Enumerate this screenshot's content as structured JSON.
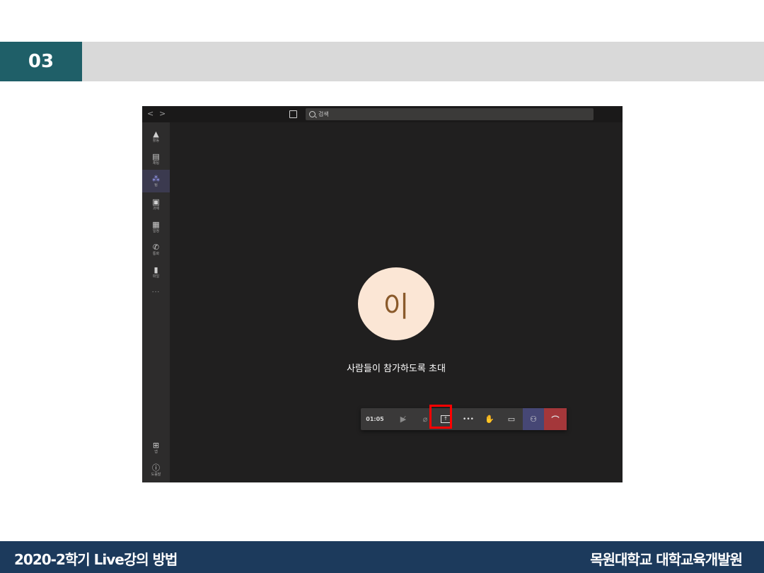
{
  "slide": {
    "section_number": "03",
    "footer_left": "2020-2학기 Live강의 방법",
    "footer_right": "목원대학교 대학교육개발원"
  },
  "teams": {
    "nav_back": "<",
    "nav_forward": ">",
    "search_placeholder": "검색",
    "rail": [
      {
        "icon": "bell-icon",
        "glyph": "🔔",
        "label": "활동"
      },
      {
        "icon": "chat-icon",
        "glyph": "▤",
        "label": "채팅"
      },
      {
        "icon": "teams-icon",
        "glyph": "⁂",
        "label": "팀",
        "active": true
      },
      {
        "icon": "assignment-icon",
        "glyph": "▣",
        "label": "과제"
      },
      {
        "icon": "calendar-icon",
        "glyph": "▦",
        "label": "일정"
      },
      {
        "icon": "phone-icon",
        "glyph": "✆",
        "label": "통화"
      },
      {
        "icon": "file-icon",
        "glyph": "▮",
        "label": "파일"
      }
    ],
    "rail_more": "...",
    "rail_bottom": [
      {
        "icon": "apps-icon",
        "glyph": "⊞",
        "label": "앱"
      },
      {
        "icon": "help-icon",
        "glyph": "ⓘ",
        "label": "도움말"
      }
    ],
    "avatar_initial": "이",
    "invite_text": "사람들이 참가하도록 초대",
    "call_timer": "01:05",
    "more_label": "•••"
  }
}
